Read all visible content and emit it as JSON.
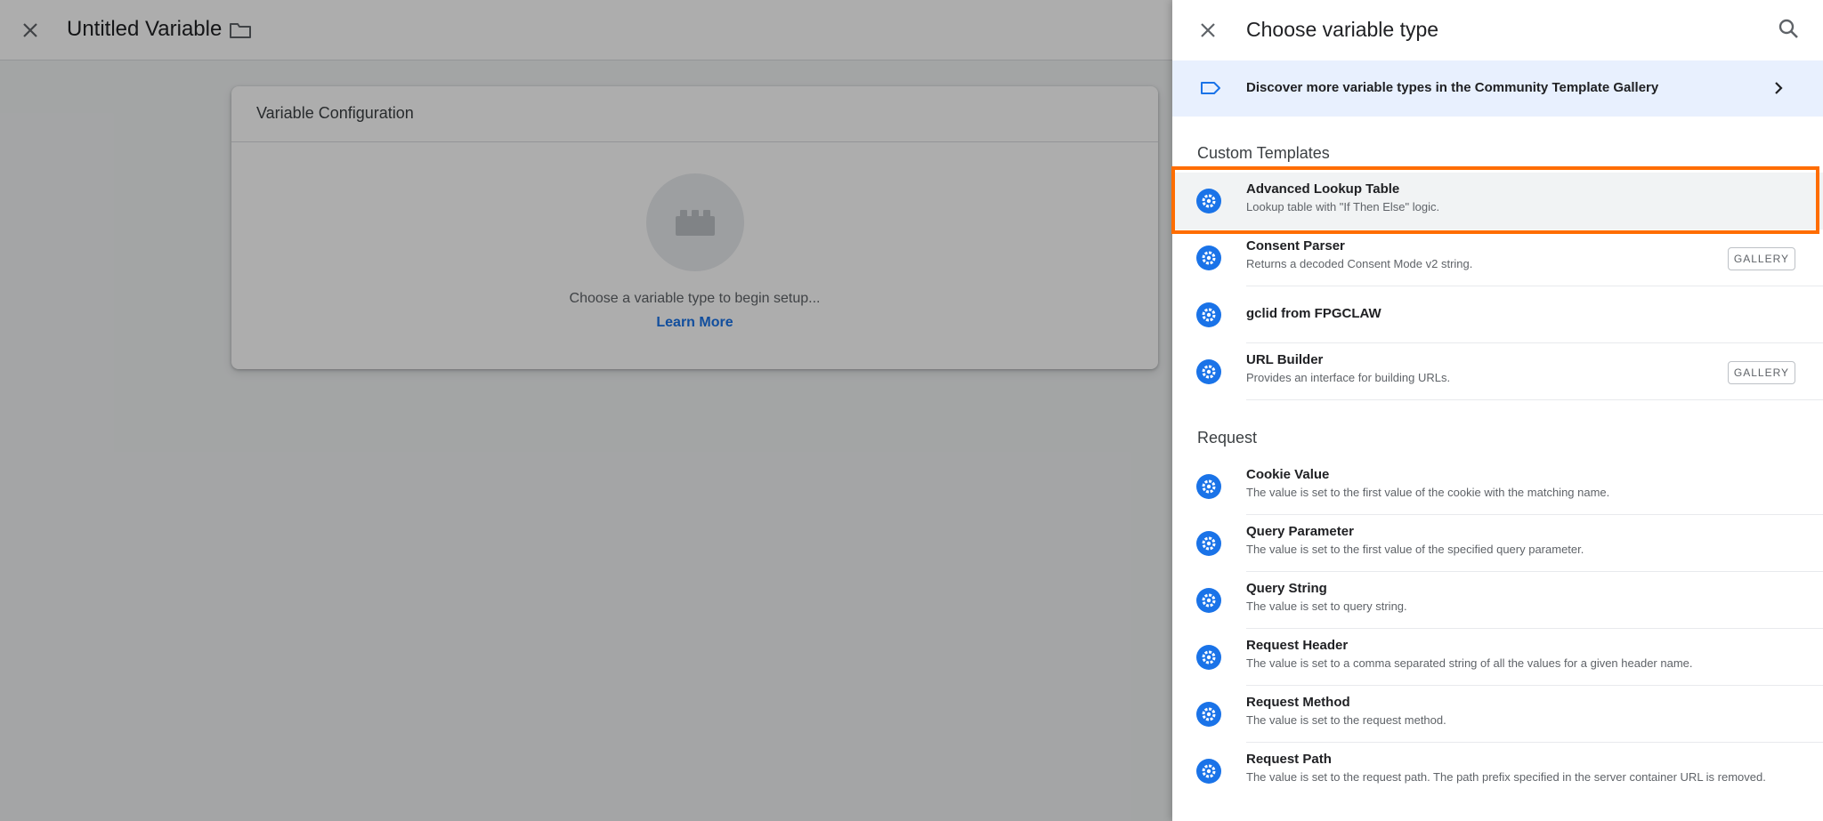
{
  "editor": {
    "title": "Untitled Variable",
    "card_title": "Variable Configuration",
    "choose_text": "Choose a variable type to begin setup...",
    "learn_more": "Learn More"
  },
  "panel": {
    "title": "Choose variable type",
    "banner_text": "Discover more variable types in the Community Template Gallery",
    "sections": [
      {
        "title": "Custom Templates",
        "items": [
          {
            "name": "Advanced Lookup Table",
            "desc": "Lookup table with \"If Then Else\" logic.",
            "badge": ""
          },
          {
            "name": "Consent Parser",
            "desc": "Returns a decoded Consent Mode v2 string.",
            "badge": "GALLERY"
          },
          {
            "name": "gclid from FPGCLAW",
            "desc": "",
            "badge": ""
          },
          {
            "name": "URL Builder",
            "desc": "Provides an interface for building URLs.",
            "badge": "GALLERY"
          }
        ]
      },
      {
        "title": "Request",
        "items": [
          {
            "name": "Cookie Value",
            "desc": "The value is set to the first value of the cookie with the matching name.",
            "badge": ""
          },
          {
            "name": "Query Parameter",
            "desc": "The value is set to the first value of the specified query parameter.",
            "badge": ""
          },
          {
            "name": "Query String",
            "desc": "The value is set to query string.",
            "badge": ""
          },
          {
            "name": "Request Header",
            "desc": "The value is set to a comma separated string of all the values for a given header name.",
            "badge": ""
          },
          {
            "name": "Request Method",
            "desc": "The value is set to the request method.",
            "badge": ""
          },
          {
            "name": "Request Path",
            "desc": "The value is set to the request path. The path prefix specified in the server container URL is removed.",
            "badge": ""
          }
        ]
      }
    ]
  },
  "colors": {
    "accent": "#1a73e8",
    "highlight": "#ff6d00",
    "banner_bg": "#e8f0fe"
  }
}
